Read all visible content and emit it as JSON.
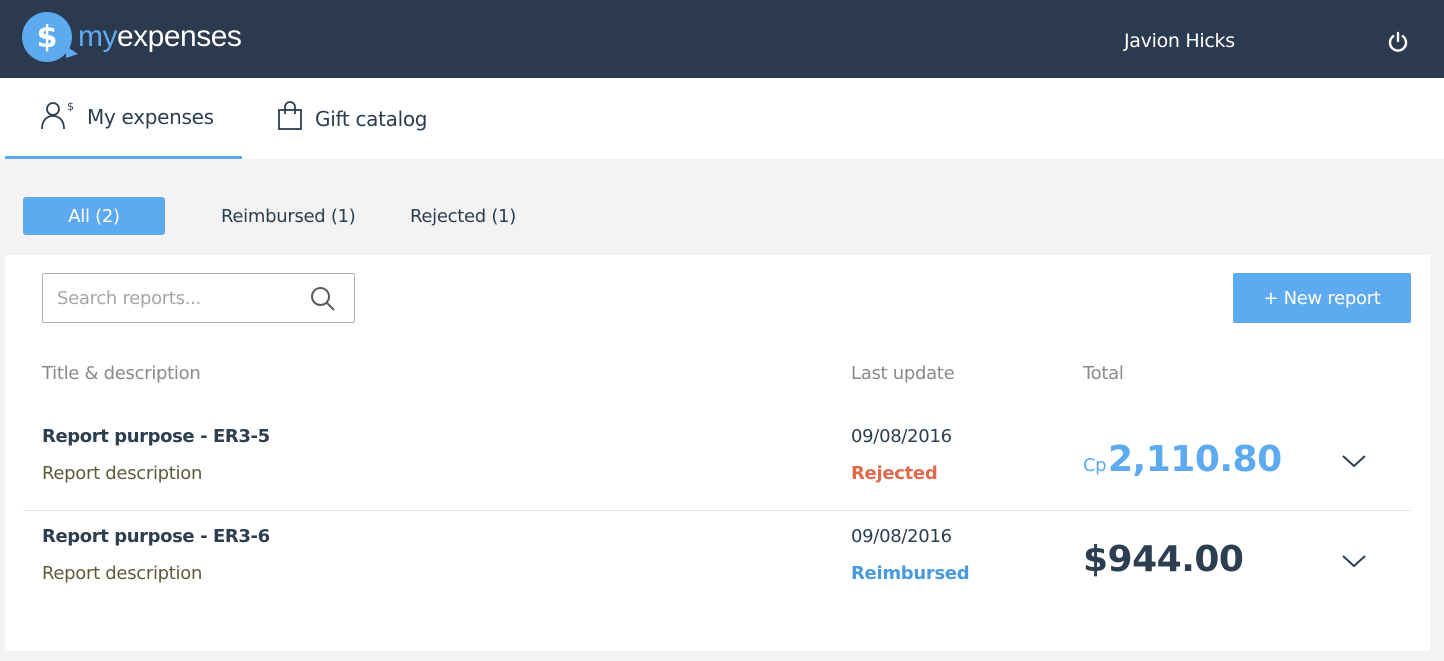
{
  "header": {
    "logo_my": "my",
    "logo_expenses": "expenses",
    "logo_symbol": "$",
    "username": "Javion Hicks",
    "power_icon": "power-icon"
  },
  "tabs": [
    {
      "label": "My expenses",
      "icon": "user-dollar-icon",
      "active": true
    },
    {
      "label": "Gift catalog",
      "icon": "shopping-bag-icon",
      "active": false
    }
  ],
  "filters": [
    {
      "label": "All (2)",
      "active": true
    },
    {
      "label": "Reimbursed (1)",
      "active": false
    },
    {
      "label": "Rejected (1)",
      "active": false
    }
  ],
  "search": {
    "placeholder": "Search reports...",
    "value": ""
  },
  "new_report_label": "+ New report",
  "columns": {
    "title": "Title & description",
    "last_update": "Last update",
    "total": "Total"
  },
  "reports": [
    {
      "title": "Report purpose - ER3-5",
      "description": "Report description",
      "date": "09/08/2016",
      "status": "Rejected",
      "status_color": "#e06a4e",
      "currency": "Cp",
      "amount": "2,110.80",
      "amount_color": "#5daaf0"
    },
    {
      "title": "Report purpose - ER3-6",
      "description": "Report description",
      "date": "09/08/2016",
      "status": "Reimbursed",
      "status_color": "#4a9ae0",
      "amount": "$944.00",
      "amount_color": "#2c3e50"
    }
  ],
  "colors": {
    "header_bg": "#2b3a4f",
    "accent": "#5daaf0"
  }
}
